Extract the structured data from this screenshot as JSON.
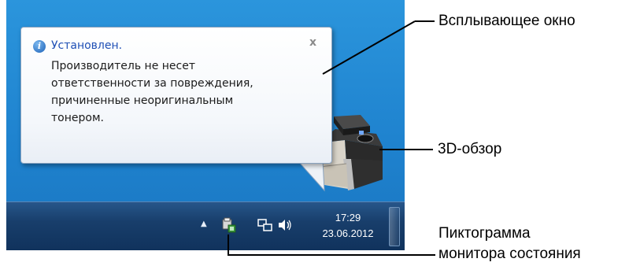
{
  "balloon": {
    "title": "Установлен.",
    "body_lines": [
      "Производитель не несет",
      "ответственности за повреждения,",
      "причиненные неоригинальным",
      "тонером."
    ],
    "close_glyph": "x"
  },
  "taskbar": {
    "tray_arrow_glyph": "▲",
    "clock_time": "17:29",
    "clock_date": "23.06.2012"
  },
  "callouts": {
    "popup": "Всплывающее окно",
    "view3d": "3D-обзор",
    "monitor_line1": "Пиктограмма",
    "monitor_line2": "монитора состояния"
  },
  "icons": [
    "info-icon",
    "close-icon",
    "printer-3d-icon",
    "status-monitor-icon",
    "network-icon",
    "volume-icon",
    "tray-arrow-icon"
  ],
  "colors": {
    "desktop": "#1f83cf",
    "taskbar": "#183e6b",
    "balloon_title": "#1f4fb5"
  }
}
